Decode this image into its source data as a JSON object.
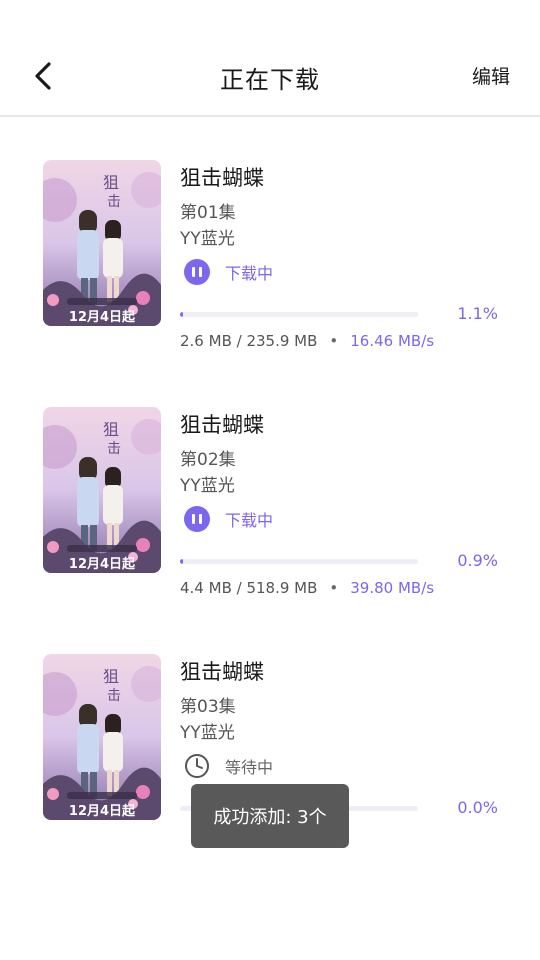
{
  "header": {
    "title": "正在下载",
    "edit_label": "编辑"
  },
  "colors": {
    "accent": "#7b68ee",
    "track": "#eeeef4",
    "toast_bg": "#595959"
  },
  "downloads": [
    {
      "title": "狙击蝴蝶",
      "episode": "第01集",
      "quality": "YY蓝光",
      "status": "下载中",
      "status_icon": "pause-icon",
      "progress": 0.011,
      "percent_text": "1.1%",
      "size_text": "2.6 MB / 235.9 MB",
      "separator": "•",
      "speed_text": "16.46 MB/s",
      "poster_text": "12月4日起"
    },
    {
      "title": "狙击蝴蝶",
      "episode": "第02集",
      "quality": "YY蓝光",
      "status": "下载中",
      "status_icon": "pause-icon",
      "progress": 0.009,
      "percent_text": "0.9%",
      "size_text": "4.4 MB / 518.9 MB",
      "separator": "•",
      "speed_text": "39.80 MB/s",
      "poster_text": "12月4日起"
    },
    {
      "title": "狙击蝴蝶",
      "episode": "第03集",
      "quality": "YY蓝光",
      "status": "等待中",
      "status_icon": "clock-icon",
      "progress": 0.0,
      "percent_text": "0.0%",
      "poster_text": "12月4日起"
    }
  ],
  "toast": {
    "text": "成功添加: 3个"
  }
}
